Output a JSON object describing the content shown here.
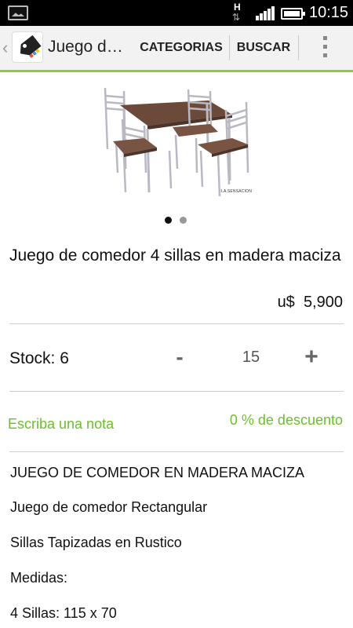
{
  "status_bar": {
    "network_label": "H",
    "network_arrows": "⇅",
    "time": "10:15",
    "icons": [
      "gallery-icon",
      "signal-icon",
      "battery-icon"
    ]
  },
  "action_bar": {
    "up_caret": "‹",
    "title": "Juego d…",
    "categorias_label": "CATEGORIAS",
    "buscar_label": "BUSCAR",
    "accent_color": "#8ccc3c"
  },
  "product": {
    "watermark": "LA SENSACION",
    "image_pages": {
      "current": 1,
      "total": 2
    },
    "title": "Juego de comedor 4 sillas en madera maciza",
    "currency": "u$",
    "price": "5,900",
    "stock_label": "Stock: 6",
    "qty_minus_label": "-",
    "qty_value": "15",
    "qty_plus_label": "+",
    "note_label": "Escriba una nota",
    "discount_label": "0 % de descuento",
    "description_lines": [
      "JUEGO DE COMEDOR EN MADERA MACIZA",
      "Juego de comedor Rectangular",
      "Sillas Tapizadas en Rustico",
      "Medidas:",
      "4 Sillas: 115 x 70"
    ]
  },
  "colors": {
    "green_text": "#6cbf2c",
    "wood": "#6b4a3a",
    "metal": "#b9b9c4"
  }
}
